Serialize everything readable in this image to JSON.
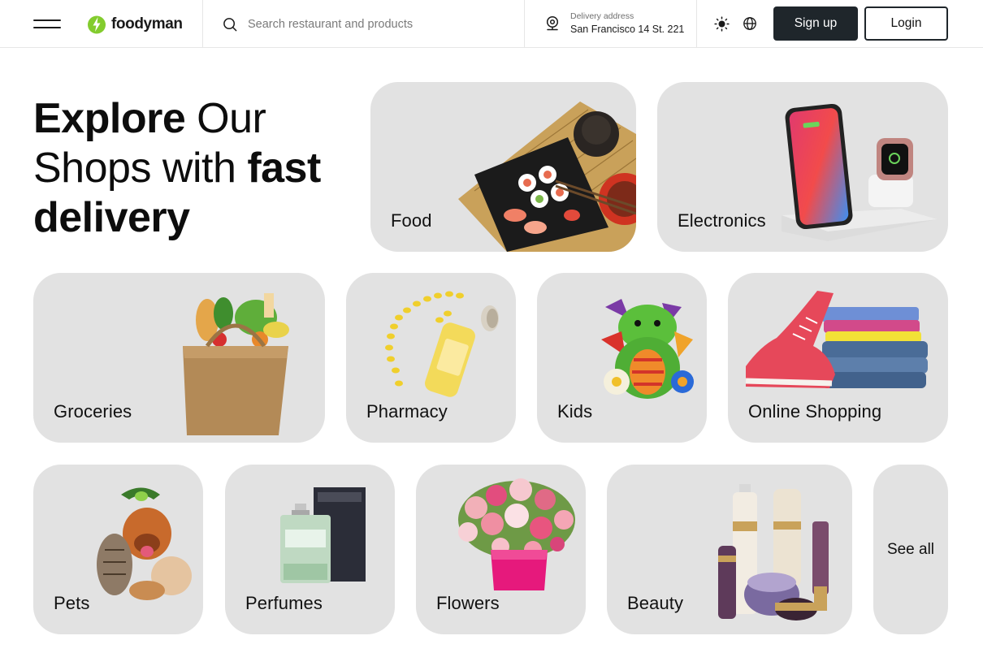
{
  "header": {
    "menu_icon": "hamburger-menu-icon",
    "brand": {
      "name": "foodyman",
      "logo_icon": "lightning-leaf-icon",
      "brand_color": "#83CC2E"
    },
    "search": {
      "placeholder": "Search restaurant and products",
      "icon": "search-icon"
    },
    "delivery": {
      "label": "Delivery address",
      "value": "San Francisco 14 St. 221",
      "icon": "location-pin-icon"
    },
    "theme_icon": "sun-icon",
    "language_icon": "globe-icon",
    "signup_label": "Sign up",
    "login_label": "Login",
    "colors": {
      "dark_button": "#1F262B",
      "card_background": "#E2E2E2"
    }
  },
  "hero": {
    "title_part1": "Explore",
    "title_part2": " Our Shops with ",
    "title_part3": "fast delivery"
  },
  "categories": [
    {
      "label": "Food",
      "image": "sushi-platter-image"
    },
    {
      "label": "Electronics",
      "image": "phone-charger-stand-image"
    },
    {
      "label": "Groceries",
      "image": "grocery-bag-image"
    },
    {
      "label": "Pharmacy",
      "image": "vitamin-bottle-image"
    },
    {
      "label": "Kids",
      "image": "plush-dragon-toy-image"
    },
    {
      "label": "Online Shopping",
      "image": "sneaker-and-clothes-image"
    },
    {
      "label": "Pets",
      "image": "pets-group-image"
    },
    {
      "label": "Perfumes",
      "image": "perfume-bottle-image"
    },
    {
      "label": "Flowers",
      "image": "flower-bouquet-image"
    },
    {
      "label": "Beauty",
      "image": "cosmetics-set-image"
    }
  ],
  "see_all_label": "See all"
}
